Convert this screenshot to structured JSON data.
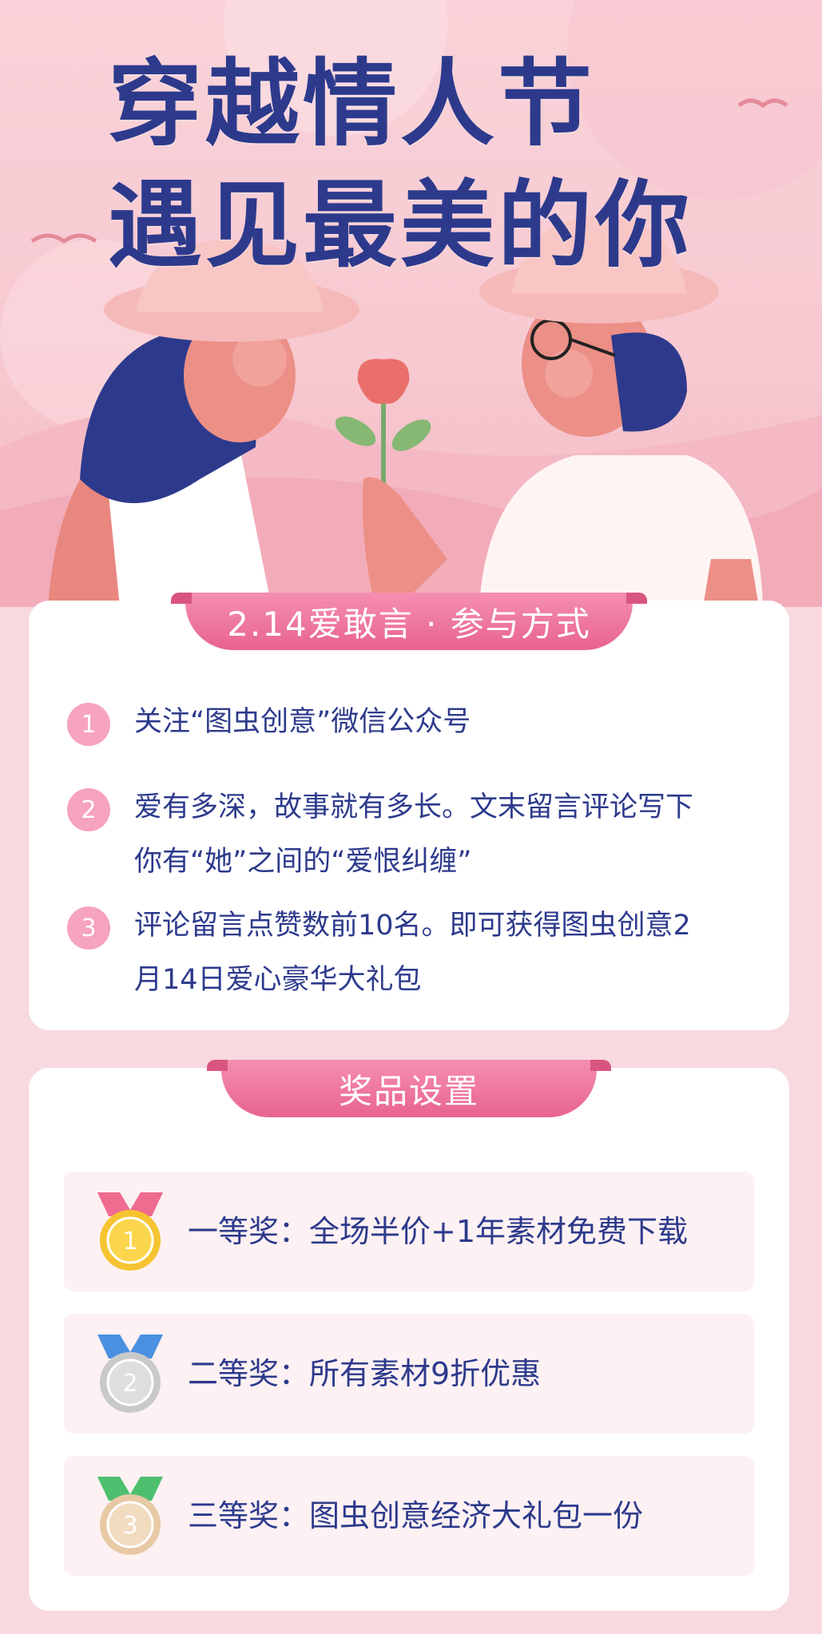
{
  "hero": {
    "title_line1": "穿越情人节",
    "title_line2": "遇见最美的你"
  },
  "how": {
    "ribbon": "2.14爱敢言 · 参与方式",
    "steps": [
      {
        "num": "1",
        "text": "关注“图虫创意”微信公众号"
      },
      {
        "num": "2",
        "text_line1": "爱有多深，故事就有多长。文末留言评论写下",
        "text_line2": "你有“她”之间的“爱恨纠缠”"
      },
      {
        "num": "3",
        "text_line1": "评论留言点赞数前10名。即可获得图虫创意2",
        "text_line2": "月14日爱心豪华大礼包"
      }
    ]
  },
  "prizes": {
    "ribbon": "奖品设置",
    "items": [
      {
        "medal_num": "1",
        "text": "一等奖：全场半价+1年素材免费下载",
        "ribbon_color": "#ef6b8f",
        "medal_color": "#f6c431",
        "medal_inner": "#fbd54c",
        "num_color": "#f6c431"
      },
      {
        "medal_num": "2",
        "text": "二等奖：所有素材9折优惠",
        "ribbon_color": "#4a90e2",
        "medal_color": "#c9c9c9",
        "medal_inner": "#dedede",
        "num_color": "#c9c9c9"
      },
      {
        "medal_num": "3",
        "text": "三等奖：图虫创意经济大礼包一份",
        "ribbon_color": "#4cc06e",
        "medal_color": "#e7c9a4",
        "medal_inner": "#f1dcc0",
        "num_color": "#e0bd93"
      }
    ]
  },
  "colors": {
    "title": "#2d3a8c",
    "accent_pink": "#e8638f",
    "background": "#f7d9df"
  }
}
